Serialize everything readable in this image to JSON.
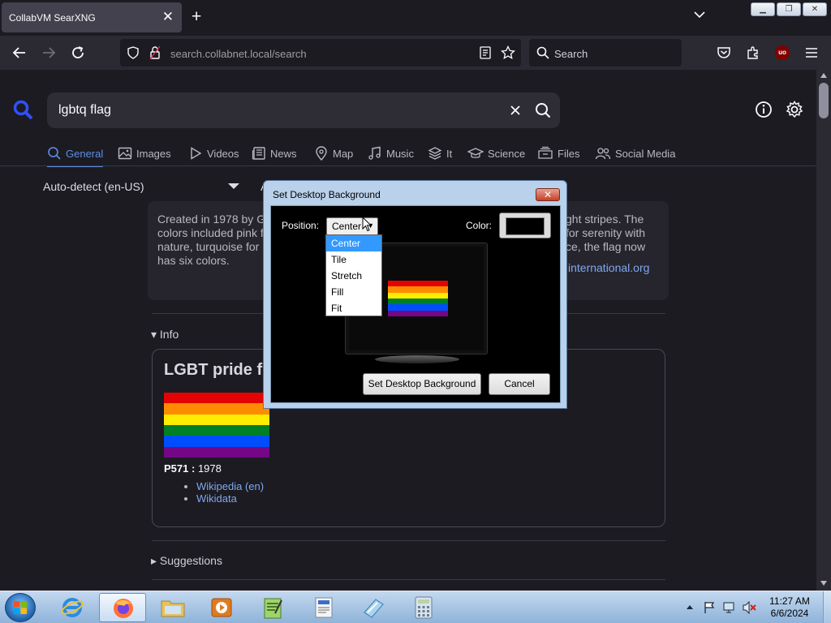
{
  "browser": {
    "tab_title": "CollabVM SearXNG",
    "url_host": "search.collabnet.local",
    "url_path": "/search",
    "search_placeholder": "Search"
  },
  "page": {
    "query": "lgbtq flag",
    "categories": [
      {
        "label": "General",
        "icon": "search-icon"
      },
      {
        "label": "Images",
        "icon": "image-icon"
      },
      {
        "label": "Videos",
        "icon": "play-icon"
      },
      {
        "label": "News",
        "icon": "newspaper-icon"
      },
      {
        "label": "Map",
        "icon": "map-pin-icon"
      },
      {
        "label": "Music",
        "icon": "music-icon"
      },
      {
        "label": "It",
        "icon": "layers-icon"
      },
      {
        "label": "Science",
        "icon": "graduation-icon"
      },
      {
        "label": "Files",
        "icon": "files-icon"
      },
      {
        "label": "Social Media",
        "icon": "people-icon"
      }
    ],
    "language": "Auto-detect (en-US)",
    "language2": "A",
    "answer": {
      "text_left": "Created in 1978 by G\ncolors included pink f\nnature, turquoise for\nhas six colors.",
      "text_right": "ght stripes. The\nfor serenity with\nce, the flag now",
      "link": "international.org"
    },
    "info_toggle": "▾ Info",
    "info_title": "LGBT pride fl",
    "flag_colors": [
      "#e40303",
      "#ff8c00",
      "#ffed00",
      "#008026",
      "#004dff",
      "#750787"
    ],
    "p571_label": "P571 :",
    "p571_value": "1978",
    "links": [
      "Wikipedia (en)",
      "Wikidata"
    ],
    "suggestions_toggle": "▸ Suggestions"
  },
  "dialog": {
    "title": "Set Desktop Background",
    "position_label": "Position:",
    "position_value": "Center",
    "color_label": "Color:",
    "color_value": "#000000",
    "options": [
      "Center",
      "Tile",
      "Stretch",
      "Fill",
      "Fit"
    ],
    "selected_option": "Center",
    "set_button": "Set Desktop Background",
    "cancel_button": "Cancel",
    "close_button": "✕"
  },
  "taskbar": {
    "time": "11:27 AM",
    "date": "6/6/2024"
  }
}
